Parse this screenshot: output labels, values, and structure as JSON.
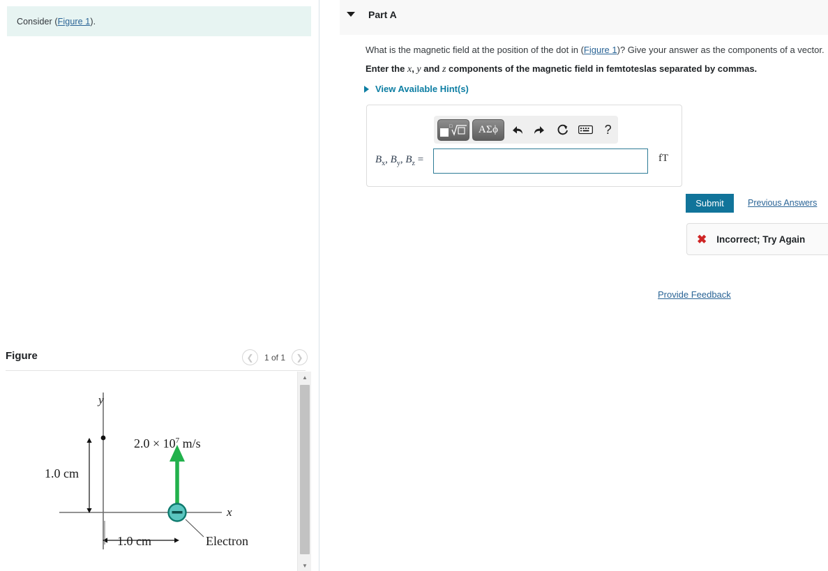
{
  "left": {
    "consider": {
      "prefix": "Consider (",
      "link": "Figure 1",
      "suffix": ").",
      "bg": "#e7f4f2"
    },
    "figure": {
      "title": "Figure",
      "count": "1 of 1",
      "prev_icon": "chevron-left-icon",
      "next_icon": "chevron-right-icon"
    }
  },
  "diagram": {
    "y_axis_label": "y",
    "x_axis_label": "x",
    "velocity_label": "2.0 × 10⁷ m/s",
    "velocity_mantissa": "2.0 × 10",
    "velocity_exponent": "7",
    "velocity_unit": "m/s",
    "vertical_distance": "1.0 cm",
    "horizontal_distance": "1.0 cm",
    "particle_label": "Electron",
    "particle_sign": "−",
    "colors": {
      "arrow": "#22b14c",
      "particle_fill": "#5bc6c0",
      "particle_stroke": "#0e7a6e",
      "axis": "#6e6e6e"
    }
  },
  "part": {
    "title": "Part A",
    "caret_icon": "caret-down-icon",
    "question_prefix": "What is the magnetic field at the position of the dot in (",
    "question_link": "Figure 1",
    "question_suffix": ")? Give your answer as the components of a vector.",
    "instruction_pre": "Enter the ",
    "instruction_x": "x",
    "instruction_mid1": ", ",
    "instruction_y": "y",
    "instruction_mid2": " and ",
    "instruction_z": "z",
    "instruction_post": " components of the magnetic field in femtoteslas separated by commas.",
    "hint_label": "View Available Hint(s)",
    "hint_icon": "triangle-right-icon"
  },
  "answer": {
    "toolbar": [
      {
        "name": "math-template-button",
        "label": "√",
        "type": "template"
      },
      {
        "name": "greek-letters-button",
        "label": "ΑΣϕ",
        "type": "greek"
      },
      {
        "name": "undo-icon",
        "label": "↶",
        "type": "icon"
      },
      {
        "name": "redo-icon",
        "label": "↷",
        "type": "icon"
      },
      {
        "name": "reset-icon",
        "label": "↺",
        "type": "icon"
      },
      {
        "name": "keyboard-icon",
        "label": "⌨",
        "type": "icon"
      },
      {
        "name": "help-icon",
        "label": "?",
        "type": "icon"
      }
    ],
    "label_b": "B",
    "sub_x": "x",
    "sub_y": "y",
    "sub_z": "z",
    "equals": "=",
    "value": "",
    "placeholder": "",
    "unit": "fT"
  },
  "actions": {
    "submit_label": "Submit",
    "previous_answers_label": "Previous Answers",
    "submit_color": "#11749a"
  },
  "feedback": {
    "icon": "cross-icon",
    "message": "Incorrect; Try Again",
    "icon_color": "#cf2525"
  },
  "footer": {
    "provide_feedback_label": "Provide Feedback"
  }
}
